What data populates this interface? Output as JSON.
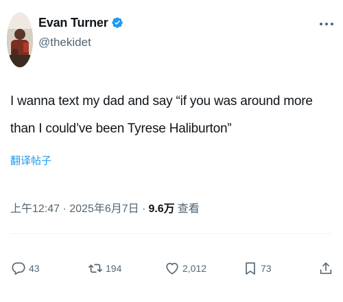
{
  "author": {
    "display_name": "Evan Turner",
    "handle": "@thekidet"
  },
  "tweet": {
    "text": "I wanna text my dad and say “if you was around more than I could’ve been Tyrese Haliburton”",
    "translate_label": "翻译帖子"
  },
  "meta": {
    "timestamp": "上午12:47 · 2025年6月7日 ·",
    "views_count": "9.6万",
    "views_label": "查看"
  },
  "actions": {
    "replies": "43",
    "retweets": "194",
    "likes": "2,012",
    "bookmarks": "73"
  },
  "colors": {
    "accent": "#1d9bf0",
    "secondary_text": "#536471",
    "primary_text": "#0f1419"
  },
  "icons": [
    "verified-badge-icon",
    "more-options-icon",
    "reply-icon",
    "retweet-icon",
    "like-icon",
    "bookmark-icon",
    "share-icon"
  ]
}
